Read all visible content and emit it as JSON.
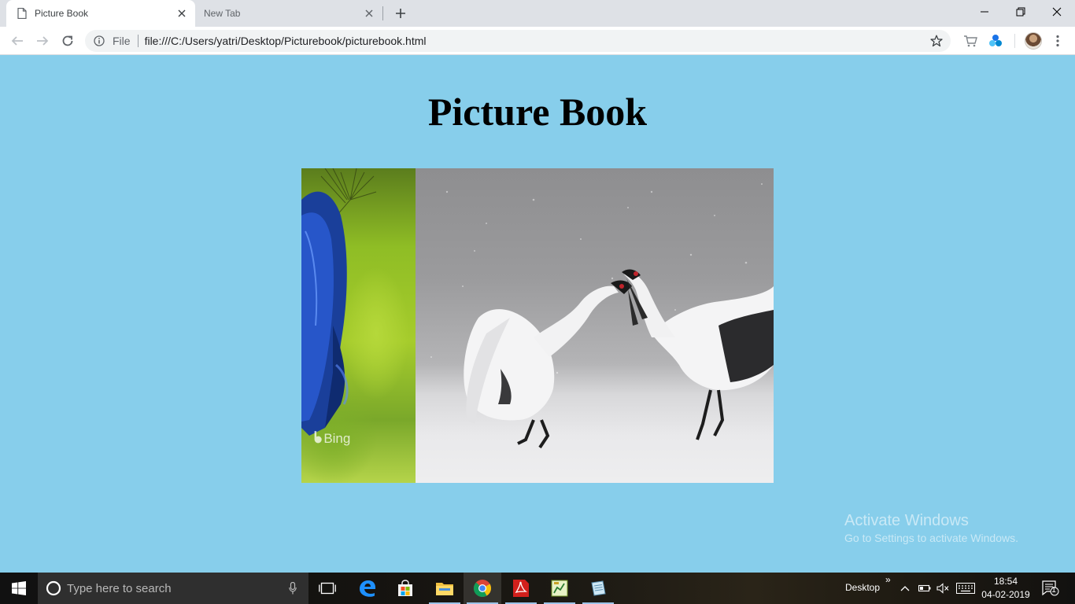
{
  "browser": {
    "tabs": [
      {
        "title": "Picture Book",
        "active": true
      },
      {
        "title": "New Tab",
        "active": false
      }
    ],
    "address_bar": {
      "security_chip": "File",
      "url": "file:///C:/Users/yatri/Desktop/Picturebook/picturebook.html"
    }
  },
  "page": {
    "title": "Picture Book",
    "background_color": "#87ceeb",
    "slideshow": {
      "images": [
        {
          "subject": "peacock",
          "watermark": "Bing"
        },
        {
          "subject": "red-crowned cranes dancing in snow"
        }
      ]
    }
  },
  "watermark": {
    "line1": "Activate Windows",
    "line2": "Go to Settings to activate Windows."
  },
  "taskbar": {
    "search_placeholder": "Type here to search",
    "apps": [
      "task-view",
      "edge",
      "store",
      "file-explorer",
      "chrome",
      "acrobat",
      "spreadsheet-app",
      "notepad-app"
    ],
    "active_app": "chrome",
    "tray": {
      "toolbar_label": "Desktop",
      "time": "18:54",
      "date": "04-02-2019",
      "notification_count": "1"
    }
  }
}
